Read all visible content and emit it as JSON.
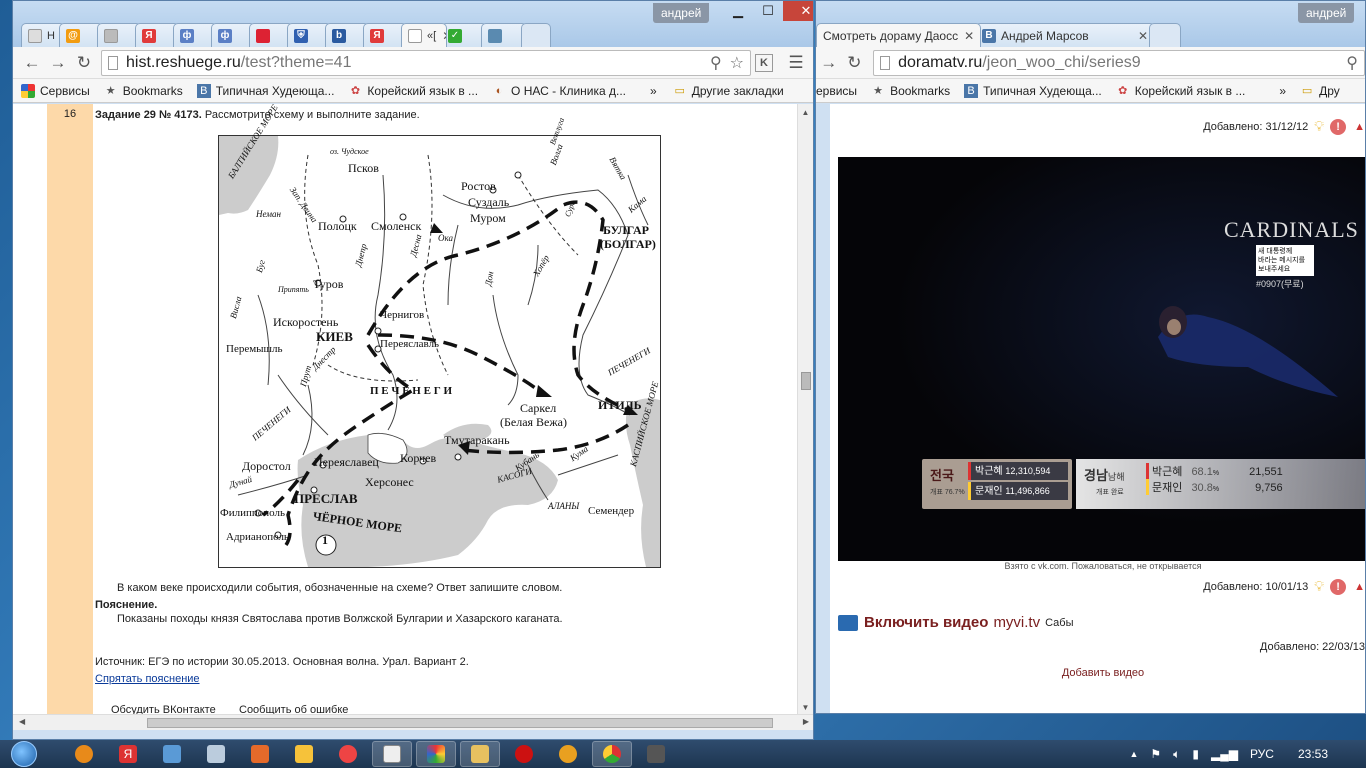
{
  "left_browser": {
    "user": "андрей",
    "tabs": [
      {
        "label": "Н",
        "color": "#ddd",
        "glyph": ""
      },
      {
        "label": "",
        "color": "#f29c11",
        "glyph": "@"
      },
      {
        "label": "",
        "color": "#bbb",
        "glyph": ""
      },
      {
        "label": "",
        "color": "#e03a3a",
        "glyph": "Я"
      },
      {
        "label": "",
        "color": "#5b7fc5",
        "glyph": "ф"
      },
      {
        "label": "",
        "color": "#5b7fc5",
        "glyph": "ф"
      },
      {
        "label": "",
        "color": "#d23",
        "glyph": ""
      },
      {
        "label": "",
        "color": "#3060b0",
        "glyph": "⛨"
      },
      {
        "label": "",
        "color": "#2a5aa0",
        "glyph": "b"
      },
      {
        "label": "",
        "color": "#e03a3a",
        "glyph": "Я"
      },
      {
        "label": "«[",
        "color": "#fff",
        "glyph": ""
      },
      {
        "label": "",
        "color": "#3a3",
        "glyph": "✓"
      },
      {
        "label": "",
        "color": "#5a8ab0",
        "glyph": ""
      }
    ],
    "url_host": "hist.reshuege.ru",
    "url_path": "/test?theme=41",
    "bookmarks": [
      {
        "label": "Сервисы",
        "icon": "grid-icon"
      },
      {
        "label": "Bookmarks",
        "icon": "star-icon"
      },
      {
        "label": "Типичная Худеюща...",
        "icon": "vk-icon"
      },
      {
        "label": "Корейский язык в ...",
        "icon": "korean-icon"
      },
      {
        "label": "О НАС - Клиника д...",
        "icon": "clinic-icon"
      }
    ],
    "bookmarks_more": "»",
    "other_bookmarks": "Другие закладки",
    "task_number": "16",
    "task_title": "Задание 29 № 4173.",
    "task_text": "Рассмотрите схему и выполните задание.",
    "question": "В каком веке происходили события, обозначенные на схеме? Ответ запишите словом.",
    "explanation_label": "Пояснение.",
    "explanation": "Показаны походы князя Святослава против Волжской Булгарии и Хазарского каганата.",
    "source": "Источник: ЕГЭ по истории 30.05.2013. Основная волна. Урал. Вариант 2.",
    "hide_link": "Спрятать пояснение",
    "discuss_link": "Обсудить ВКонтакте",
    "report_link": "Сообщить об ошибке",
    "map_labels": {
      "baltic": "БАЛТИЙСКОЕ МОРЕ",
      "pskov": "Псков",
      "chudskoe": "оз. Чудское",
      "rostov": "Ростов",
      "suzdal": "Суздаль",
      "murom": "Муром",
      "bulgar": "БУЛГАР",
      "bolgar": "(БОЛГАР)",
      "polotsk": "Полоцк",
      "smolensk": "Смоленск",
      "neman": "Неман",
      "turov": "Туров",
      "iskorosten": "Искоростень",
      "kiev": "КИЕВ",
      "chernigov": "Чернигов",
      "pereyaslavl": "Переяславль",
      "peremyshl": "Перемышль",
      "pechenegi": "П Е Ч Е Н Е Г И",
      "pechenegi_w": "ПЕЧЕНЕГИ",
      "pechenegi_e": "ПЕЧЕНЕГИ",
      "sarkel": "Саркел",
      "belaya_vezha": "(Белая Вежа)",
      "itil": "ИТИЛЬ",
      "tmutarakan": "Тмутаракань",
      "dorostol": "Доростол",
      "pereyaslavets": "Переяславец",
      "korchev": "Корчев",
      "chersones": "Херсонес",
      "preslav": "ПРЕСЛАВ",
      "filippopol": "Филиппополь",
      "adrianopol": "Адрианополь",
      "black_sea": "ЧЁРНОЕ МОРЕ",
      "caspian": "КАСПИЙСКОЕ МОРЕ",
      "semender": "Семендер",
      "alany": "АЛАНЫ",
      "kasogi": "КАСОГИ",
      "volga": "Волга",
      "oka": "Ока",
      "dnepr": "Днепр",
      "desna": "Десна",
      "don": "Дон",
      "khoper": "Хопёр",
      "kama": "Кама",
      "vyatka": "Вятка",
      "dunay": "Дунай",
      "prut": "Прут",
      "dnestr": "Днестр",
      "kuban": "Кубань",
      "kuma": "Кума",
      "marker": "1",
      "visla": "Висла",
      "bug": "Буг",
      "z_dvina": "Зап. Двина",
      "vetluga": "Ветлуга",
      "sura": "Сура",
      "pripyat": "Припять"
    }
  },
  "right_browser": {
    "user": "андрей",
    "tabs": [
      {
        "label": "Смотреть дораму Даосс",
        "color": "#fff"
      },
      {
        "label": "Андрей Марсов",
        "color": "#4a76a8",
        "glyph": "B"
      }
    ],
    "url_host": "doramatv.ru",
    "url_path": "/jeon_woo_chi/series9",
    "bookmarks": [
      {
        "label": "ервисы"
      },
      {
        "label": "Bookmarks",
        "icon": "star-icon"
      },
      {
        "label": "Типичная Худеюща...",
        "icon": "vk-icon"
      },
      {
        "label": "Корейский язык в ...",
        "icon": "korean-icon"
      }
    ],
    "bookmarks_more": "»",
    "other_bookmarks": "Дру",
    "added1": "Добавлено: 31/12/12",
    "added2": "Добавлено: 10/01/13",
    "added3": "Добавлено: 22/03/13",
    "video_credit": "Взято с vk.com. Пожаловаться, не открывается",
    "enable_video": "Включить видео",
    "enable_video_src": "myvi.tv",
    "enable_video_subs": "Сабы",
    "add_video": "Добавить видео",
    "video": {
      "banner": "CARDINALS",
      "hashtag": "#0907(무료)",
      "box1": "새 대통령께",
      "box2": "바라는 메시지를",
      "box3": "보내주세요",
      "left_label": "전국",
      "left_sub": "개표 76.7%",
      "c1": "박근혜",
      "v1": "12,310,594",
      "c2": "문재인",
      "v2": "11,496,866",
      "mid_label": "경남",
      "mid_label2": "남해",
      "mid_sub": "개표 완료",
      "p1": "68.1",
      "n1": "21,551",
      "p2": "30.8",
      "n2": "9,756",
      "pct": "%"
    }
  },
  "taskbar": {
    "lang": "РУС",
    "time": "23:53"
  }
}
